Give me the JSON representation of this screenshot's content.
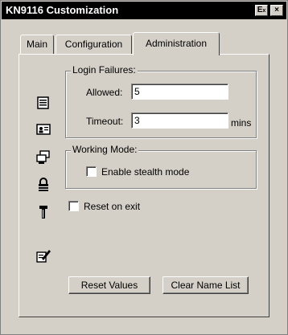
{
  "window": {
    "title": "KN9116 Customization",
    "title_buttons": [
      {
        "name": "help",
        "glyph": "E"
      },
      {
        "name": "close",
        "glyph": "×"
      }
    ]
  },
  "tabs": [
    {
      "label": "Main",
      "active": false
    },
    {
      "label": "Configuration",
      "active": false
    },
    {
      "label": "Administration",
      "active": true
    }
  ],
  "sidebar_icons": [
    "list-icon",
    "user-card-icon",
    "computers-icon",
    "lock-icon",
    "tools-icon",
    "edit-note-icon"
  ],
  "login_failures": {
    "title": "Login Failures:",
    "allowed_label": "Allowed:",
    "allowed_value": "5",
    "timeout_label": "Timeout:",
    "timeout_value": "3",
    "timeout_unit": "mins"
  },
  "working_mode": {
    "title": "Working Mode:",
    "stealth_label": "Enable stealth mode",
    "stealth_checked": false
  },
  "reset_on_exit": {
    "label": "Reset on exit",
    "checked": false
  },
  "buttons": {
    "reset_values": "Reset Values",
    "clear_name_list": "Clear Name List"
  },
  "colors": {
    "face": "#d4d0c8",
    "titlebar": "#000000",
    "field": "#ffffff"
  }
}
